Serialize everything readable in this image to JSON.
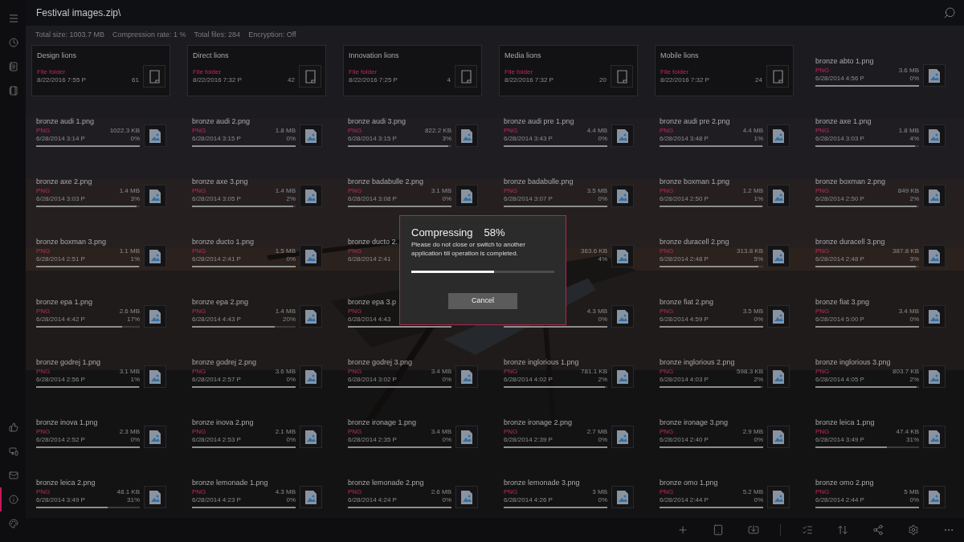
{
  "window": {
    "title": "Festival images.zip\\"
  },
  "sidebar_items": [
    {
      "selected": false
    },
    {
      "selected": false
    },
    {
      "selected": false
    },
    {
      "selected": false
    },
    {
      "selected": false
    },
    {
      "selected": false
    },
    {
      "selected": true
    },
    {
      "selected": false
    }
  ],
  "stats": [
    "Total size: 1003.7 MB",
    "Compression rate: 1 %",
    "Total files: 284",
    "Encryption: Off"
  ],
  "folders": [
    {
      "name": "Design lions",
      "type": "File folder",
      "date": "8/22/2016 7:55 P",
      "count": "61"
    },
    {
      "name": "Direct lions",
      "type": "File folder",
      "date": "8/22/2016 7:32 P",
      "count": "42"
    },
    {
      "name": "Innovation lions",
      "type": "File folder",
      "date": "8/22/2016 7:25 P",
      "count": "4"
    },
    {
      "name": "Media lions",
      "type": "File folder",
      "date": "8/22/2016 7:32 P",
      "count": "20"
    },
    {
      "name": "Mobile lions",
      "type": "File folder",
      "date": "8/22/2016 7:32 P",
      "count": "24"
    }
  ],
  "files": [
    {
      "kind": "full",
      "name": "bronze abto 1.png",
      "type": "PNG",
      "date": "6/28/2014 4:56 P",
      "size": "3.6 MB",
      "percent": "0%",
      "level": 1
    },
    {
      "kind": "full",
      "name": "bronze audi 1.png",
      "type": "PNG",
      "date": "6/28/2014 3:14 P",
      "size": "1022.3 KB",
      "percent": "0%",
      "level": 1
    },
    {
      "kind": "full",
      "name": "bronze audi 2.png",
      "type": "PNG",
      "date": "6/28/2014 3:15 P",
      "size": "1.8 MB",
      "percent": "0%",
      "level": 1
    },
    {
      "kind": "full",
      "name": "bronze audi 3.png",
      "type": "PNG",
      "date": "6/28/2014 3:15 P",
      "size": "822.2 KB",
      "percent": "3%",
      "level": 0.97
    },
    {
      "kind": "full",
      "name": "bronze audi pre 1.png",
      "type": "PNG",
      "date": "6/28/2014 3:43 P",
      "size": "4.4 MB",
      "percent": "0%",
      "level": 1
    },
    {
      "kind": "full",
      "name": "bronze audi pre 2.png",
      "type": "PNG",
      "date": "6/28/2014 3:48 P",
      "size": "4.4 MB",
      "percent": "1%",
      "level": 0.99
    },
    {
      "kind": "full",
      "name": "bronze axe 1.png",
      "type": "PNG",
      "date": "6/28/2014 3:03 P",
      "size": "1.8 MB",
      "percent": "4%",
      "level": 0.96
    },
    {
      "kind": "full",
      "name": "bronze axe 2.png",
      "type": "PNG",
      "date": "6/28/2014 3:03 P",
      "size": "1.4 MB",
      "percent": "3%",
      "level": 0.97
    },
    {
      "kind": "full",
      "name": "bronze axe 3.png",
      "type": "PNG",
      "date": "6/28/2014 3:05 P",
      "size": "1.4 MB",
      "percent": "2%",
      "level": 0.98
    },
    {
      "kind": "full",
      "name": "bronze badabulle 2.png",
      "type": "PNG",
      "date": "6/28/2014 3:08 P",
      "size": "3.1 MB",
      "percent": "0%",
      "level": 1
    },
    {
      "kind": "full",
      "name": "bronze badabulle.png",
      "type": "PNG",
      "date": "6/28/2014 3:07 P",
      "size": "3.5 MB",
      "percent": "0%",
      "level": 1
    },
    {
      "kind": "full",
      "name": "bronze boxman 1.png",
      "type": "PNG",
      "date": "6/28/2014 2:50 P",
      "size": "1.2 MB",
      "percent": "1%",
      "level": 0.99
    },
    {
      "kind": "full",
      "name": "bronze boxman 2.png",
      "type": "PNG",
      "date": "6/28/2014 2:50 P",
      "size": "849 KB",
      "percent": "2%",
      "level": 0.98
    },
    {
      "kind": "full",
      "name": "bronze boxman 3.png",
      "type": "PNG",
      "date": "6/28/2014 2:51 P",
      "size": "1.1 MB",
      "percent": "1%",
      "level": 0.99
    },
    {
      "kind": "full",
      "name": "bronze ducto 1.png",
      "type": "PNG",
      "date": "6/28/2014 2:41 P",
      "size": "1.5 MB",
      "percent": "0%",
      "level": 1
    },
    {
      "kind": "left_part",
      "name": "bronze ducto 2.",
      "type": "PNG",
      "date": "6/28/2014 2:41"
    },
    {
      "kind": "right_part",
      "size": "363.6 KB",
      "percent": "4%"
    },
    {
      "kind": "full",
      "name": "bronze duracell 2.png",
      "type": "PNG",
      "date": "6/28/2014 2:48 P",
      "size": "313.8 KB",
      "percent": "5%",
      "level": 0.95
    },
    {
      "kind": "full",
      "name": "bronze duracell 3.png",
      "type": "PNG",
      "date": "6/28/2014 2:48 P",
      "size": "387.8 KB",
      "percent": "3%",
      "level": 0.97
    },
    {
      "kind": "full",
      "name": "bronze epa 1.png",
      "type": "PNG",
      "date": "6/28/2014 4:42 P",
      "size": "2.6 MB",
      "percent": "17%",
      "level": 0.83
    },
    {
      "kind": "full",
      "name": "bronze epa 2.png",
      "type": "PNG",
      "date": "6/28/2014 4:43 P",
      "size": "1.4 MB",
      "percent": "20%",
      "level": 0.8
    },
    {
      "kind": "left_part",
      "name": "bronze epa 3.p",
      "type": "PNG",
      "date": "6/28/2014 4:43",
      "level": 1
    },
    {
      "kind": "right_part",
      "size": "4.3 MB",
      "percent": "0%",
      "level": 1
    },
    {
      "kind": "full",
      "name": "bronze fiat 2.png",
      "type": "PNG",
      "date": "6/28/2014 4:59 P",
      "size": "3.5 MB",
      "percent": "0%",
      "level": 1
    },
    {
      "kind": "full",
      "name": "bronze fiat 3.png",
      "type": "PNG",
      "date": "6/28/2014 5:00 P",
      "size": "3.4 MB",
      "percent": "0%",
      "level": 1
    },
    {
      "kind": "full",
      "name": "bronze godrej 1.png",
      "type": "PNG",
      "date": "6/28/2014 2:56 P",
      "size": "3.1 MB",
      "percent": "1%",
      "level": 0.99
    },
    {
      "kind": "full",
      "name": "bronze godrej 2.png",
      "type": "PNG",
      "date": "6/28/2014 2:57 P",
      "size": "3.6 MB",
      "percent": "0%",
      "level": 1
    },
    {
      "kind": "full",
      "name": "bronze godrej 3.png",
      "type": "PNG",
      "date": "6/28/2014 3:02 P",
      "size": "3.4 MB",
      "percent": "0%",
      "level": 1
    },
    {
      "kind": "full",
      "name": "bronze inglorious 1.png",
      "type": "PNG",
      "date": "6/28/2014 4:02 P",
      "size": "781.1 KB",
      "percent": "2%",
      "level": 0.98
    },
    {
      "kind": "full",
      "name": "bronze inglorious 2.png",
      "type": "PNG",
      "date": "6/28/2014 4:03 P",
      "size": "598.3 KB",
      "percent": "2%",
      "level": 0.98
    },
    {
      "kind": "full",
      "name": "bronze inglorious 3.png",
      "type": "PNG",
      "date": "6/28/2014 4:05 P",
      "size": "803.7 KB",
      "percent": "2%",
      "level": 0.98
    },
    {
      "kind": "full",
      "name": "bronze inova 1.png",
      "type": "PNG",
      "date": "6/28/2014 2:52 P",
      "size": "2.3 MB",
      "percent": "0%",
      "level": 1
    },
    {
      "kind": "full",
      "name": "bronze inova 2.png",
      "type": "PNG",
      "date": "6/28/2014 2:53 P",
      "size": "2.1 MB",
      "percent": "0%",
      "level": 1
    },
    {
      "kind": "full",
      "name": "bronze ironage 1.png",
      "type": "PNG",
      "date": "6/28/2014 2:35 P",
      "size": "3.4 MB",
      "percent": "0%",
      "level": 1
    },
    {
      "kind": "full",
      "name": "bronze ironage 2.png",
      "type": "PNG",
      "date": "6/28/2014 2:39 P",
      "size": "2.7 MB",
      "percent": "0%",
      "level": 1
    },
    {
      "kind": "full",
      "name": "bronze ironage 3.png",
      "type": "PNG",
      "date": "6/28/2014 2:40 P",
      "size": "2.9 MB",
      "percent": "0%",
      "level": 1
    },
    {
      "kind": "full",
      "name": "bronze leica 1.png",
      "type": "PNG",
      "date": "6/28/2014 3:49 P",
      "size": "47.4 KB",
      "percent": "31%",
      "level": 0.69
    },
    {
      "kind": "full",
      "name": "bronze leica 2.png",
      "type": "PNG",
      "date": "6/28/2014 3:49 P",
      "size": "48.1 KB",
      "percent": "31%",
      "level": 0.69
    },
    {
      "kind": "full",
      "name": "bronze lemonade 1.png",
      "type": "PNG",
      "date": "6/28/2014 4:23 P",
      "size": "4.3 MB",
      "percent": "0%",
      "level": 1
    },
    {
      "kind": "full",
      "name": "bronze lemonade 2.png",
      "type": "PNG",
      "date": "6/28/2014 4:24 P",
      "size": "2.6 MB",
      "percent": "0%",
      "level": 1
    },
    {
      "kind": "full",
      "name": "bronze lemonade 3.png",
      "type": "PNG",
      "date": "6/28/2014 4:26 P",
      "size": "3 MB",
      "percent": "0%",
      "level": 1
    },
    {
      "kind": "full",
      "name": "bronze omo 1.png",
      "type": "PNG",
      "date": "6/28/2014 2:44 P",
      "size": "5.2 MB",
      "percent": "0%",
      "level": 1
    },
    {
      "kind": "full",
      "name": "bronze omo 2.png",
      "type": "PNG",
      "date": "6/28/2014 2:44 P",
      "size": "5 MB",
      "percent": "0%",
      "level": 1
    }
  ],
  "dialog": {
    "title": "Compressing",
    "percent": "58%",
    "message": "Please do not close or switch to another application till operation is completed.",
    "level": 0.58,
    "button": "Cancel"
  }
}
